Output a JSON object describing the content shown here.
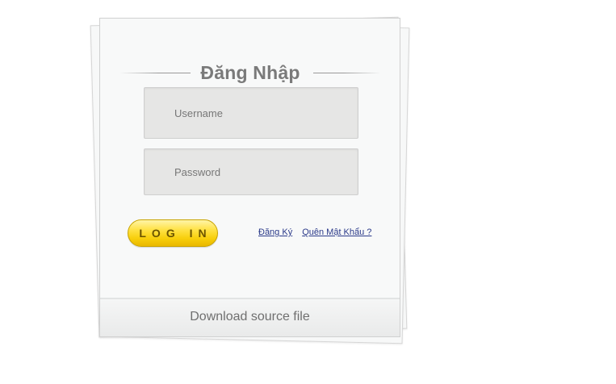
{
  "login": {
    "title": "Đăng Nhập",
    "username_placeholder": "Username",
    "password_placeholder": "Password",
    "login_button": "LOG IN",
    "register_link": "Đăng Ký",
    "forgot_link": "Quên Mật Khẩu ?",
    "download_label": "Download source file"
  }
}
